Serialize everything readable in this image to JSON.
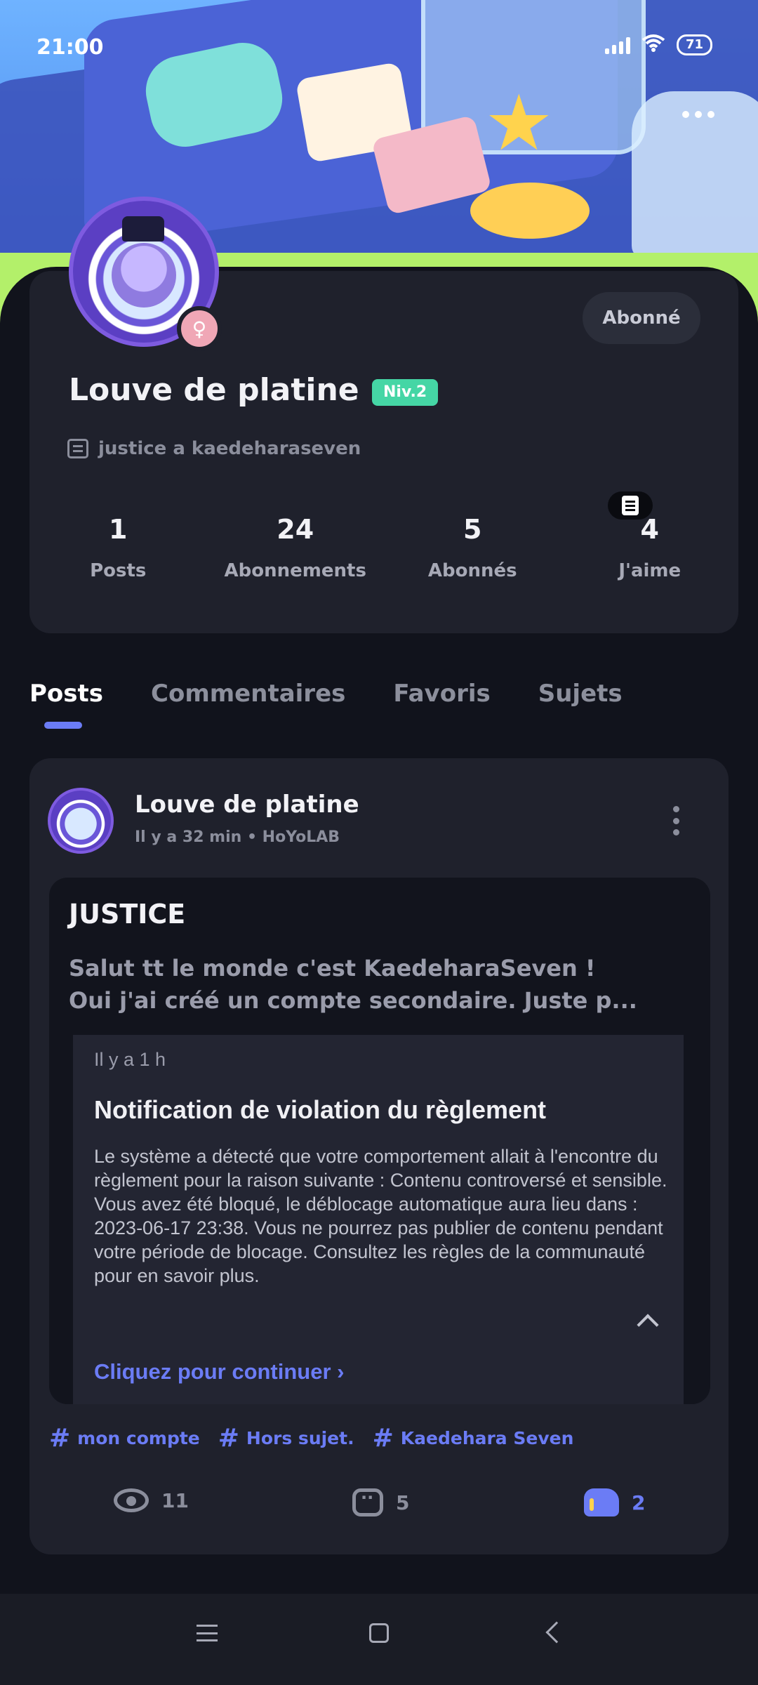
{
  "status_bar": {
    "time": "21:00",
    "battery": "71",
    "icons": [
      "signal-icon",
      "wifi-icon",
      "battery-icon"
    ]
  },
  "header": {
    "more_icon": "more-horizontal-icon"
  },
  "profile": {
    "follow_label": "Abonné",
    "username": "Louve de platine",
    "level": "Niv.2",
    "bio": "justice a kaedeharaseven",
    "stats": [
      {
        "value": "1",
        "label": "Posts"
      },
      {
        "value": "24",
        "label": "Abonnements"
      },
      {
        "value": "5",
        "label": "Abonnés"
      },
      {
        "value": "4",
        "label": "J'aime"
      }
    ]
  },
  "tabs": [
    {
      "label": "Posts",
      "active": true
    },
    {
      "label": "Commentaires",
      "active": false
    },
    {
      "label": "Favoris",
      "active": false
    },
    {
      "label": "Sujets",
      "active": false
    }
  ],
  "post": {
    "author": "Louve de platine",
    "meta": "Il y a 32 min • HoYoLAB",
    "title": "JUSTICE",
    "text_line1": "Salut tt le monde c'est KaedeharaSeven !",
    "text_line2": "Oui j'ai créé un compte secondaire. Juste p...",
    "screenshot": {
      "time": "Il y a 1 h",
      "title": "Notification de violation du règlement",
      "body": "Le système a détecté que votre comportement allait à l'encontre du règlement pour la raison suivante : Contenu controversé et sensible. Vous avez été bloqué, le déblocage automatique aura lieu dans : 2023-06-17 23:38. Vous ne pourrez pas publier de contenu pendant votre période de blocage. Consultez les règles de la communauté pour en savoir plus.",
      "link": "Cliquez pour continuer"
    },
    "tags": [
      "mon compte",
      "Hors sujet.",
      "Kaedehara Seven"
    ],
    "views": "11",
    "comments": "5",
    "likes": "2"
  },
  "colors": {
    "accent": "#6b7cf5",
    "level_badge": "#45d6a5",
    "background": "#11131c",
    "card": "#1f212c"
  }
}
